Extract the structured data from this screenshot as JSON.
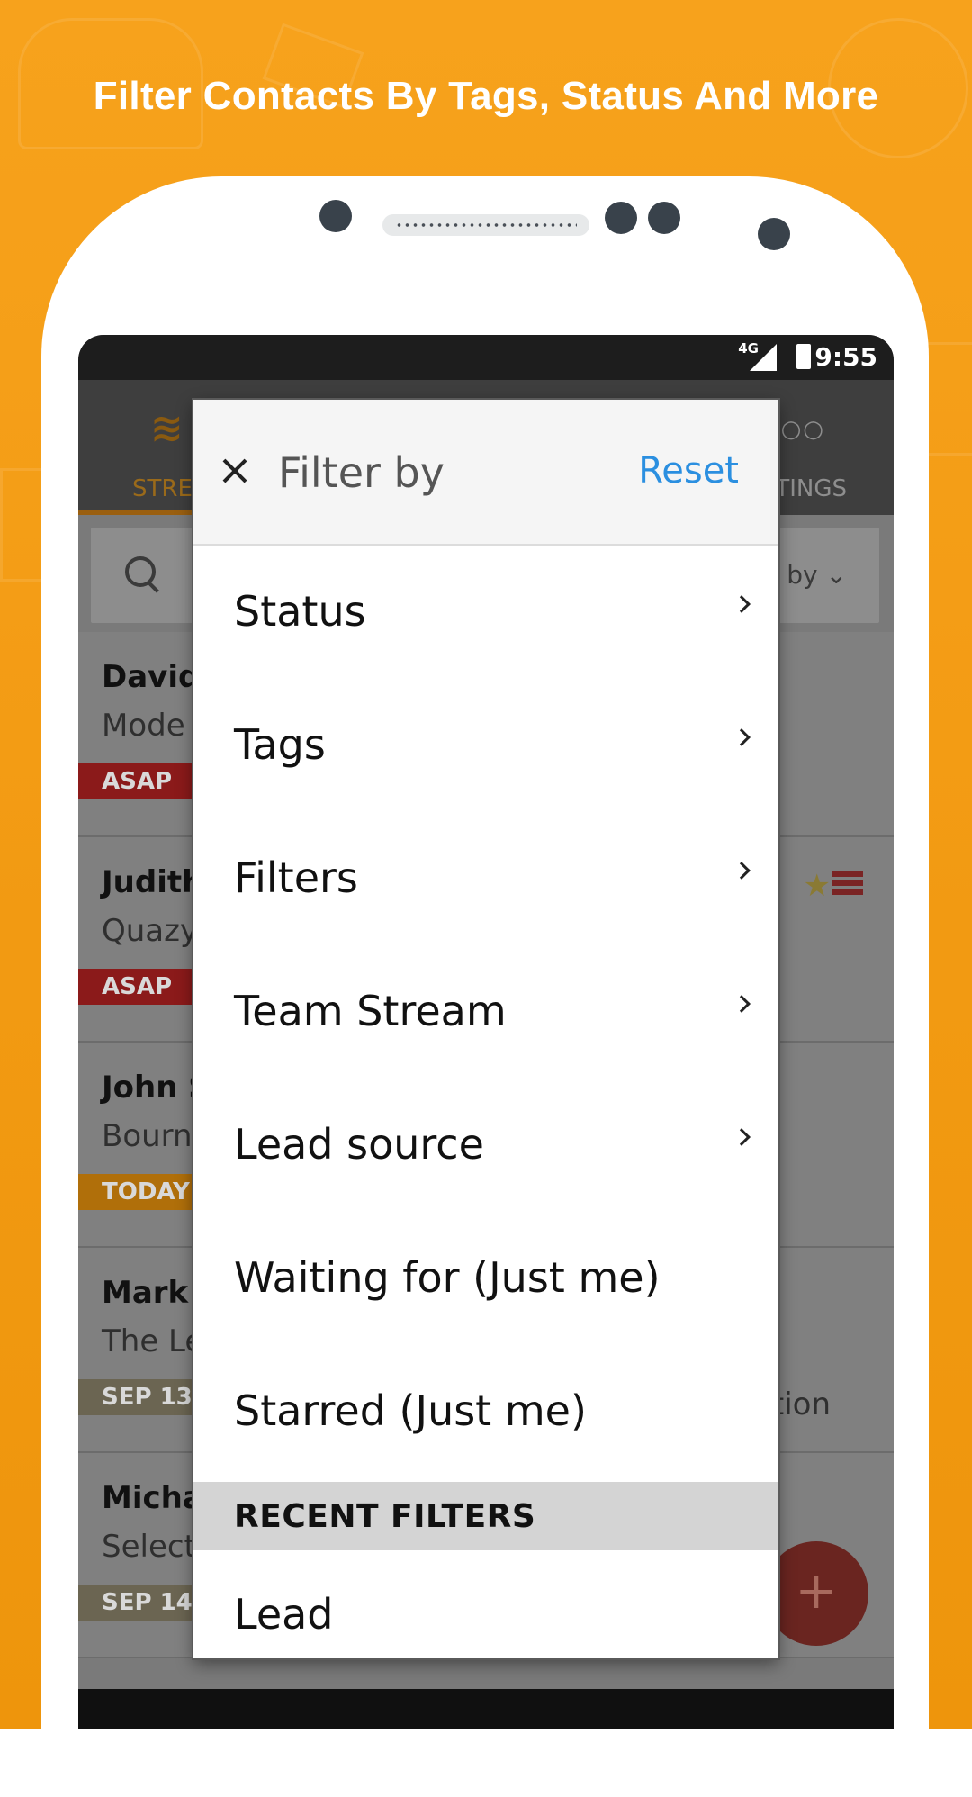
{
  "headline": "Filter Contacts By Tags, Status And More",
  "status_bar": {
    "time": "9:55",
    "network": "4G"
  },
  "app": {
    "tab_left": "STRE",
    "tab_right": "TINGS",
    "menu_dots": "○○",
    "sort_label": "by ⌄"
  },
  "contacts": [
    {
      "name": "David",
      "subtitle": "Mode",
      "badge": "ASAP",
      "badge_color": "#8b1a1a"
    },
    {
      "name": "Judith",
      "subtitle": "Quazy",
      "badge": "ASAP",
      "badge_color": "#8b1a1a"
    },
    {
      "name": "John S",
      "subtitle": "Bourn",
      "badge": "TODAY",
      "badge_color": "#b06f0a"
    },
    {
      "name": "Mark",
      "subtitle": "The Le",
      "badge": "SEP 13",
      "badge_color": "#6b6552",
      "extra": "tion"
    },
    {
      "name": "Micha",
      "subtitle": "Select",
      "badge": "SEP 14",
      "badge_color": "#6b6552"
    }
  ],
  "fab_label": "+",
  "dialog": {
    "title": "Filter by",
    "reset_label": "Reset",
    "items": [
      {
        "label": "Status",
        "has_chevron": true
      },
      {
        "label": "Tags",
        "has_chevron": true
      },
      {
        "label": "Filters",
        "has_chevron": true
      },
      {
        "label": "Team Stream",
        "has_chevron": true
      },
      {
        "label": "Lead source",
        "has_chevron": true
      },
      {
        "label": "Waiting for (Just me)",
        "has_chevron": false
      },
      {
        "label": "Starred (Just me)",
        "has_chevron": false
      }
    ],
    "recent_header": "RECENT FILTERS",
    "recent_items": [
      {
        "label": "Lead"
      }
    ]
  },
  "colors": {
    "background": "#f7a21c",
    "accent_blue": "#2b8fe0"
  }
}
